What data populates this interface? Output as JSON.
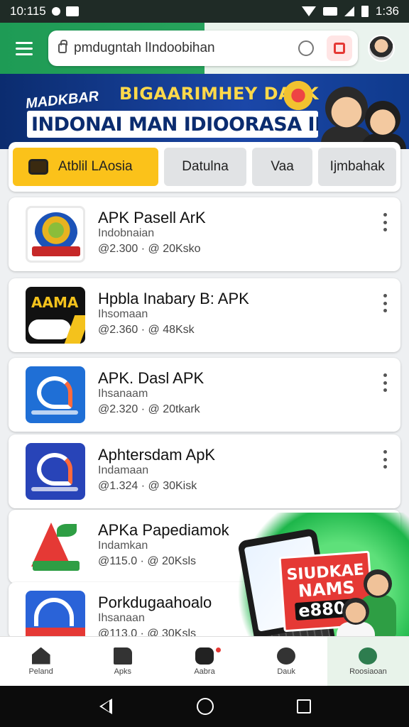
{
  "status_bar": {
    "time": "10:115",
    "battery": "1:36"
  },
  "browser": {
    "url": "pmdugntah lIndoobihan"
  },
  "banner": {
    "small_text": "MADKBAR",
    "headline": "BIGAARIMHEY DARK",
    "main_text": "INDONAI MAN IDIOORASA INDARSIA"
  },
  "tabs": [
    {
      "label": "Atblil LAosia",
      "active": true
    },
    {
      "label": "Datulna",
      "active": false
    },
    {
      "label": "Vaa",
      "active": false
    },
    {
      "label": "Ijmbahak",
      "active": false
    }
  ],
  "apps": [
    {
      "title": "APK Pasell ArK",
      "subtitle": "Indobnaian",
      "meta": "@2.300 · @ 20Ksko",
      "icon": "garuda-crest-icon"
    },
    {
      "title": "Hpbla Inabary B: APK",
      "subtitle": "Ihsomaan",
      "meta": "@2.360 · @ 48Ksk",
      "icon": "apk-black-icon"
    },
    {
      "title": "APK. Dasl APK",
      "subtitle": "Ihsanaam",
      "meta": "@2.320 · @ 20tkark",
      "icon": "blue-a-icon"
    },
    {
      "title": "Aphtersdam ApK",
      "subtitle": "Indamaan",
      "meta": "@1.324 · @ 30Kisk",
      "icon": "navy-a-icon"
    },
    {
      "title": "APKa Papediamok",
      "subtitle": "Indamkan",
      "meta": "@115.0 · @ 20Ksls",
      "icon": "red-a-icon"
    },
    {
      "title": "Porkdugaahoalo",
      "subtitle": "Ihsanaan",
      "meta": "@113.0 · @ 30Ksls",
      "icon": "red-blue-m-icon"
    }
  ],
  "promo": {
    "line1": "SIUDKAE",
    "line2": "NAMS",
    "line3": "e8808"
  },
  "bottom_nav": [
    {
      "label": "Peland",
      "icon": "home-icon"
    },
    {
      "label": "Apks",
      "icon": "apps-icon"
    },
    {
      "label": "Aabra",
      "icon": "notification-icon"
    },
    {
      "label": "Dauk",
      "icon": "person-icon"
    },
    {
      "label": "Roosiaoan",
      "icon": "leaf-icon"
    }
  ]
}
